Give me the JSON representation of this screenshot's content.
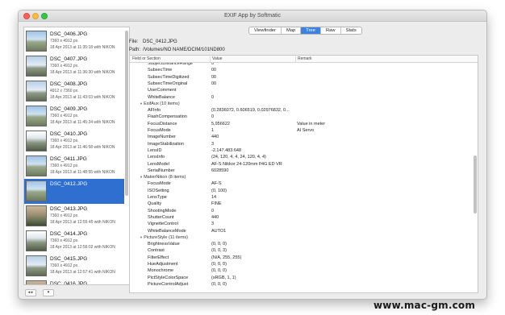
{
  "window": {
    "title": "EXIF App by Softmatic"
  },
  "sidebar": {
    "items": [
      {
        "name": "DSC_0406.JPG",
        "size": "7360 x 4912 px.",
        "date": "18 Apr 2013 at 11:35:18 with NIKON"
      },
      {
        "name": "DSC_0407.JPG",
        "size": "7360 x 4912 px.",
        "date": "18 Apr 2013 at 11:36:30 with NIKON"
      },
      {
        "name": "DSC_0408.JPG",
        "size": "4912 x 7360 px.",
        "date": "18 Apr 2013 at 11:43:03 with NIKON"
      },
      {
        "name": "DSC_0409.JPG",
        "size": "7360 x 4912 px.",
        "date": "18 Apr 2013 at 11:45:34 with NIKON"
      },
      {
        "name": "DSC_0410.JPG",
        "size": "7360 x 4912 px.",
        "date": "18 Apr 2013 at 11:46:58 with NIKON"
      },
      {
        "name": "DSC_0411.JPG",
        "size": "7360 x 4912 px.",
        "date": "18 Apr 2013 at 11:48:55 with NIKON"
      },
      {
        "name": "DSC_0412.JPG",
        "size": "",
        "date": ""
      },
      {
        "name": "DSC_0413.JPG",
        "size": "7360 x 4912 px.",
        "date": "18 Apr 2013 at 12:55:45 with NIKON"
      },
      {
        "name": "DSC_0414.JPG",
        "size": "7360 x 4912 px.",
        "date": "18 Apr 2013 at 12:56:02 with NIKON"
      },
      {
        "name": "DSC_0415.JPG",
        "size": "7360 x 4912 px.",
        "date": "18 Apr 2013 at 12:57:41 with NIKON"
      },
      {
        "name": "DSC_0416.JPG",
        "size": "7360 x 4912 px.",
        "date": ""
      }
    ],
    "selected_index": 6,
    "buttons": {
      "left": "◂ ▸",
      "right": "▾"
    },
    "split_handle": "‖"
  },
  "tabs": [
    {
      "label": "Viewfinder",
      "active": false
    },
    {
      "label": "Map",
      "active": false
    },
    {
      "label": "Tree",
      "active": true
    },
    {
      "label": "Raw",
      "active": false
    },
    {
      "label": "Stats",
      "active": false
    }
  ],
  "file": {
    "label": "File:",
    "value": "DSC_0412.JPG"
  },
  "path": {
    "label": "Path:",
    "value": "/Volumes/NO NAME/DCIM/101ND800"
  },
  "tree": {
    "columns": [
      "Field or Section",
      "Value",
      "Remark"
    ],
    "rows": [
      {
        "field": "SubjectDistanceRange",
        "value": "0",
        "remark": "",
        "indent": 2,
        "section": false
      },
      {
        "field": "SubsecTime",
        "value": "00",
        "remark": "",
        "indent": 2,
        "section": false
      },
      {
        "field": "SubsecTimeDigitized",
        "value": "00",
        "remark": "",
        "indent": 2,
        "section": false
      },
      {
        "field": "SubsecTimeOriginal",
        "value": "00",
        "remark": "",
        "indent": 2,
        "section": false
      },
      {
        "field": "UserComment",
        "value": "",
        "remark": "",
        "indent": 2,
        "section": false
      },
      {
        "field": "WhiteBalance",
        "value": "0",
        "remark": "",
        "indent": 2,
        "section": false
      },
      {
        "field": "ExifAux (10 items)",
        "value": "",
        "remark": "",
        "indent": 1,
        "section": true
      },
      {
        "field": "AFInfo",
        "value": "(0.2836072, 0.606519, 0.02976832, 0...",
        "remark": "",
        "indent": 2,
        "section": false
      },
      {
        "field": "FlashCompensation",
        "value": "0",
        "remark": "",
        "indent": 2,
        "section": false
      },
      {
        "field": "FocusDistance",
        "value": "5,956622",
        "remark": "Value in meter",
        "indent": 2,
        "section": false
      },
      {
        "field": "FocusMode",
        "value": "1",
        "remark": "AI Servo",
        "indent": 2,
        "section": false
      },
      {
        "field": "ImageNumber",
        "value": "440",
        "remark": "",
        "indent": 2,
        "section": false
      },
      {
        "field": "ImageStabilization",
        "value": "3",
        "remark": "",
        "indent": 2,
        "section": false
      },
      {
        "field": "LensID",
        "value": "-2.147.483.648",
        "remark": "",
        "indent": 2,
        "section": false
      },
      {
        "field": "LensInfo",
        "value": "(24, 120, 4, 4, 24, 120, 4, 4)",
        "remark": "",
        "indent": 2,
        "section": false
      },
      {
        "field": "LensModel",
        "value": "AF-S Nikkor 24-120mm f/4G ED VR",
        "remark": "",
        "indent": 2,
        "section": false
      },
      {
        "field": "SerialNumber",
        "value": "6028590",
        "remark": "",
        "indent": 2,
        "section": false
      },
      {
        "field": "MakerNikon (8 items)",
        "value": "",
        "remark": "",
        "indent": 1,
        "section": true
      },
      {
        "field": "FocusMode",
        "value": "AF-S",
        "remark": "",
        "indent": 2,
        "section": false
      },
      {
        "field": "ISOSetting",
        "value": "(0, 100)",
        "remark": "",
        "indent": 2,
        "section": false
      },
      {
        "field": "LensType",
        "value": "14",
        "remark": "",
        "indent": 2,
        "section": false
      },
      {
        "field": "Quality",
        "value": "FINE",
        "remark": "",
        "indent": 2,
        "section": false
      },
      {
        "field": "ShootingMode",
        "value": "0",
        "remark": "",
        "indent": 2,
        "section": false
      },
      {
        "field": "ShutterCount",
        "value": "440",
        "remark": "",
        "indent": 2,
        "section": false
      },
      {
        "field": "VignetteControl",
        "value": "3",
        "remark": "",
        "indent": 2,
        "section": false
      },
      {
        "field": "WhiteBalanceMode",
        "value": "AUTO1",
        "remark": "",
        "indent": 2,
        "section": false
      },
      {
        "field": "PictureStyle (11 items)",
        "value": "",
        "remark": "",
        "indent": 1,
        "section": true
      },
      {
        "field": "BrightnessValue",
        "value": "(0, 0, 0)",
        "remark": "",
        "indent": 2,
        "section": false
      },
      {
        "field": "Contrast",
        "value": "(0, 0, 3)",
        "remark": "",
        "indent": 2,
        "section": false
      },
      {
        "field": "FilterEffect",
        "value": "(N/A, 255, 255)",
        "remark": "",
        "indent": 2,
        "section": false
      },
      {
        "field": "HueAdjustment",
        "value": "(0, 0, 0)",
        "remark": "",
        "indent": 2,
        "section": false
      },
      {
        "field": "Monochrome",
        "value": "(0, 0, 0)",
        "remark": "",
        "indent": 2,
        "section": false
      },
      {
        "field": "PictStyleColorSpace",
        "value": "(sRGB, 1, 1)",
        "remark": "",
        "indent": 2,
        "section": false
      },
      {
        "field": "PictureControlAdjust",
        "value": "(0, 0, 0)",
        "remark": "",
        "indent": 2,
        "section": false
      }
    ]
  },
  "watermark": "www.mac-gm.com",
  "colors": {
    "selection": "#2f6fd0",
    "active_tab": "#3d82df"
  }
}
